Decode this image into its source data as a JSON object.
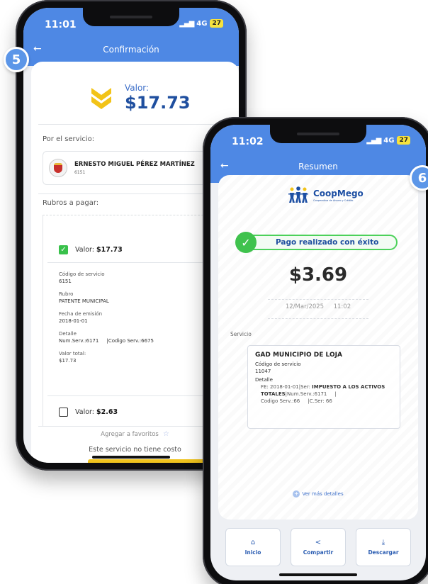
{
  "steps": {
    "left": "5",
    "right": "6"
  },
  "phone1": {
    "status": {
      "time": "11:01",
      "network": "4G",
      "battery": "27"
    },
    "header": {
      "title": "Confirmación"
    },
    "valor": {
      "label": "Valor:",
      "amount": "$17.73"
    },
    "por_servicio_label": "Por el servicio:",
    "payee": {
      "name": "ERNESTO MIGUEL PÉREZ MARTÍNEZ",
      "code": "6151"
    },
    "rubros_label": "Rubros a pagar:",
    "rubro1": {
      "label": "Valor:",
      "amount": "$17.73",
      "checked": true,
      "codigo_label": "Código de servicio",
      "codigo": "6151",
      "rubro_label": "Rubro",
      "rubro": "PATENTE MUNICIPAL",
      "fecha_label": "Fecha de emisión",
      "fecha": "2018-01-01",
      "detalle_label": "Detalle",
      "detalle": "Num.Serv.:6171     |Codigo Serv.:6675",
      "total_label": "Valor total:",
      "total": "$17.73"
    },
    "rubro2": {
      "label": "Valor:",
      "amount": "$2.63",
      "checked": false
    },
    "favoritos": "Agregar a favoritos",
    "no_cost": "Este servicio no tiene costo"
  },
  "phone2": {
    "status": {
      "time": "11:02",
      "network": "4G",
      "battery": "27"
    },
    "header": {
      "title": "Resumen"
    },
    "logo": {
      "name": "CoopMego",
      "tagline": "Cooperativa de Ahorro y Crédito"
    },
    "success": "Pago realizado con éxito",
    "amount": "$3.69",
    "date": "12/Mar/2025",
    "time": "11:02",
    "servicio_label": "Servicio",
    "service": {
      "name": "GAD MUNICIPIO DE LOJA",
      "codigo_label": "Código de servicio",
      "codigo": "11047",
      "detalle_label": "Detalle",
      "detalle_line1": "FE: 2018-01-01|Ser: ",
      "detalle_bold": "IMPUESTO A LOS ACTIVOS TOTALES",
      "detalle_line2": "|Num.Serv.:6171     |",
      "detalle_line3": "Codigo Serv.:66     |C.Ser: 66"
    },
    "ver_mas": "Ver más detalles",
    "buttons": {
      "inicio": "Inicio",
      "compartir": "Compartir",
      "descargar": "Descargar"
    }
  },
  "colors": {
    "primary": "#4e88e4",
    "success": "#3fc24d",
    "accent_yellow": "#f0c31d",
    "dark_blue": "#1f4f9f"
  }
}
